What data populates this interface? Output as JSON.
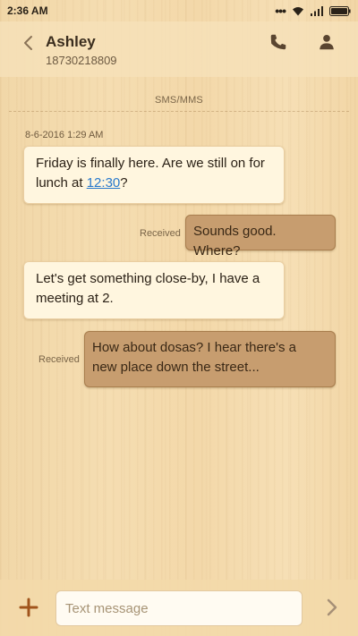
{
  "status_bar": {
    "time": "2:36 AM",
    "more_dots": "•••"
  },
  "header": {
    "contact_name": "Ashley",
    "contact_number": "18730218809"
  },
  "conversation": {
    "channel_label": "SMS/MMS",
    "timestamp": "8-6-2016 1:29 AM",
    "messages": [
      {
        "direction": "incoming",
        "text_before": "Friday is finally here. Are we still on for lunch at ",
        "link": "12:30",
        "text_after": "?"
      },
      {
        "direction": "outgoing",
        "status": "Received",
        "text": "Sounds good. Where?"
      },
      {
        "direction": "incoming",
        "text": "Let's get something close-by, I have a meeting at 2."
      },
      {
        "direction": "outgoing",
        "status": "Received",
        "text": "How about dosas? I hear there's a new place down the street..."
      }
    ]
  },
  "composer": {
    "placeholder": "Text message",
    "value": ""
  },
  "icons": {
    "back": "chevron-left-icon",
    "call": "phone-icon",
    "contact": "person-icon",
    "attach": "plus-icon",
    "send": "send-chevron-icon",
    "wifi": "wifi-icon",
    "signal": "signal-icon",
    "battery": "battery-icon"
  },
  "colors": {
    "accent": "#a0541c",
    "link": "#2979cc",
    "incoming_bubble": "#fff6df",
    "outgoing_bubble": "#c79d6f"
  }
}
